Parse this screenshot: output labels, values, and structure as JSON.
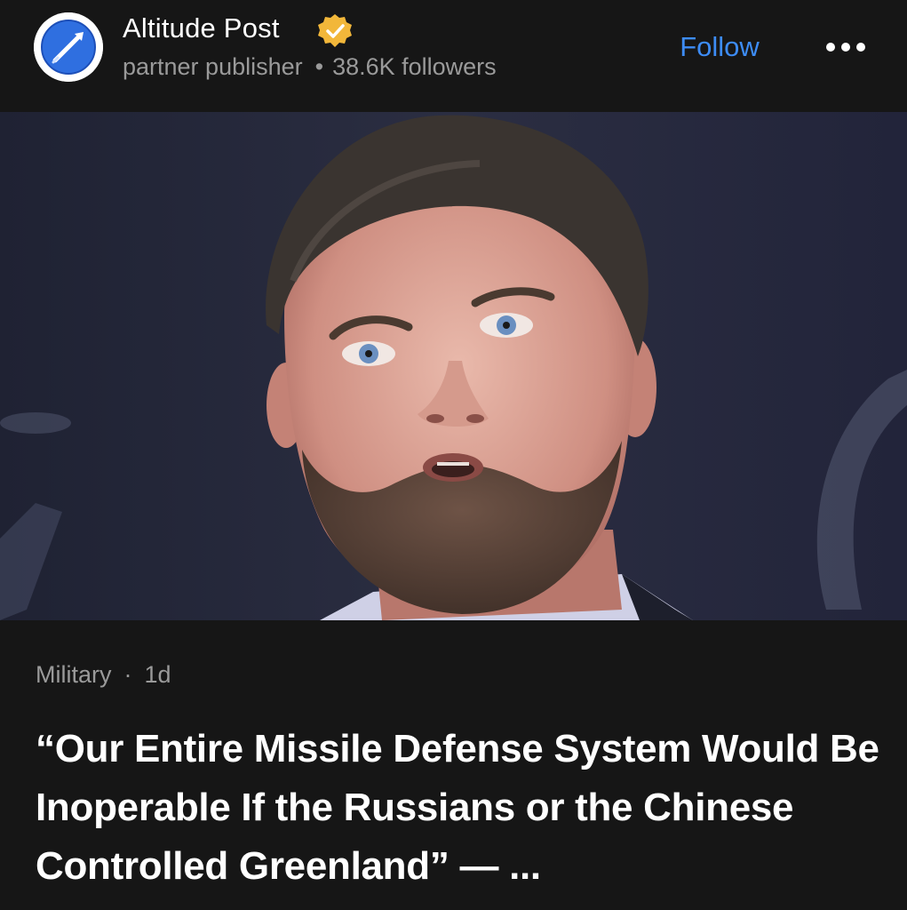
{
  "header": {
    "publisher_name": "Altitude Post",
    "publisher_type": "partner publisher",
    "separator": "•",
    "followers": "38.6K followers",
    "follow_label": "Follow",
    "more_icon": "ellipsis-icon",
    "avatar_icon": "rocket-logo-icon",
    "verified_icon": "verified-badge-icon"
  },
  "article": {
    "category": "Military",
    "separator": "·",
    "age": "1d",
    "headline": "“Our Entire Missile Defense System Would Be Inoperable If the Russians or the Chinese Controlled Greenland” — ..."
  },
  "colors": {
    "background": "#161616",
    "accent": "#3d8cf5",
    "muted_text": "#9a9a9a",
    "verified_badge": "#f2b73a",
    "logo_blue": "#2f6fe0"
  }
}
